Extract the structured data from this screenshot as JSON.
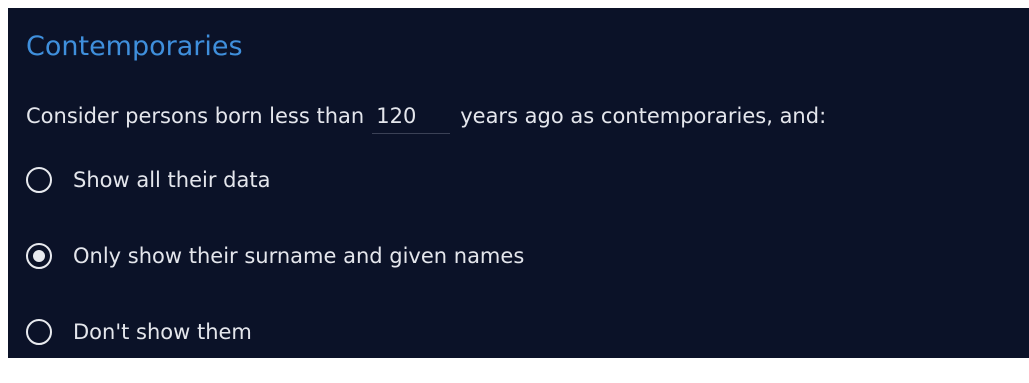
{
  "section": {
    "title": "Contemporaries",
    "sentence_before": "Consider persons born less than",
    "years_value": "120",
    "sentence_after": "years ago as contemporaries, and:"
  },
  "options": [
    {
      "label": "Show all their data",
      "selected": false
    },
    {
      "label": "Only show their surname and given names",
      "selected": true
    },
    {
      "label": "Don't show them",
      "selected": false
    }
  ],
  "colors": {
    "background": "#0b1228",
    "heading": "#3f8fdc",
    "text": "#e4e6ec"
  }
}
